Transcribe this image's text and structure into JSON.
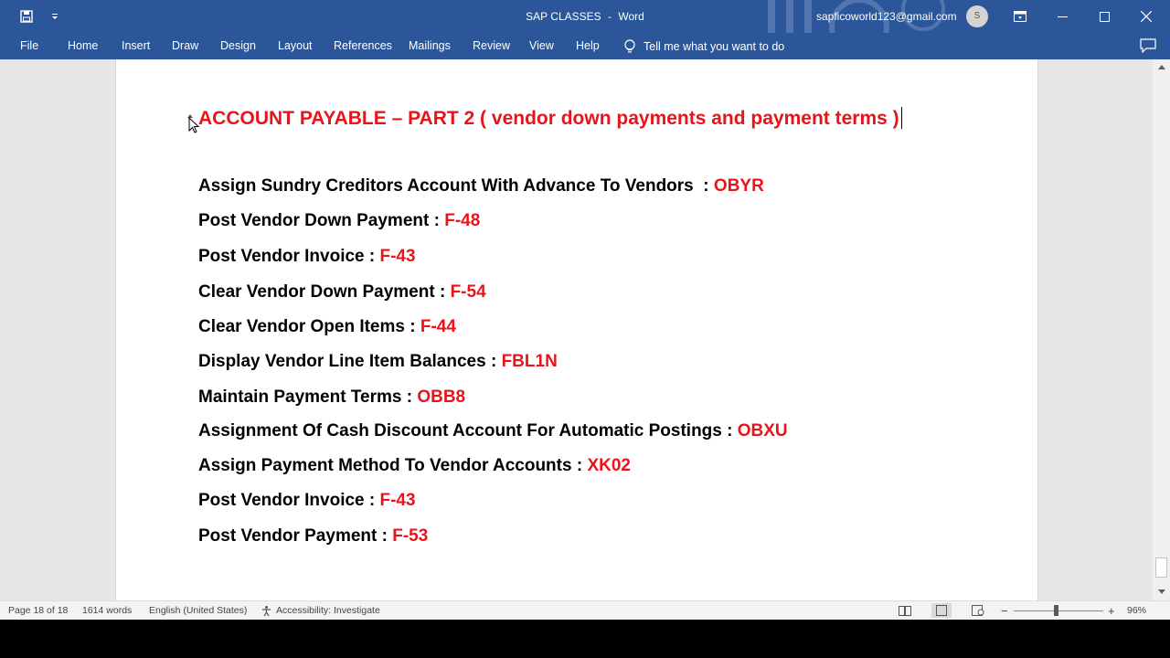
{
  "window": {
    "doc_name": "SAP CLASSES",
    "separator": "-",
    "app_name": "Word",
    "user_email": "sapficoworld123@gmail.com",
    "avatar_initial": "S",
    "title_bar_color": "#2b579a"
  },
  "menu": {
    "tabs": [
      "File",
      "Home",
      "Insert",
      "Draw",
      "Design",
      "Layout",
      "References",
      "Mailings",
      "Review",
      "View",
      "Help"
    ],
    "tell_me": "Tell me what you want to do"
  },
  "document": {
    "heading": "ACCOUNT PAYABLE – PART 2 ( vendor down payments and payment terms )",
    "heading_color": "#e8141a",
    "lines": [
      {
        "label": "Assign Sundry Creditors Account With Advance To Vendors  : ",
        "code": "OBYR"
      },
      {
        "label": "Post Vendor Down Payment : ",
        "code": "F-48"
      },
      {
        "label": "Post Vendor Invoice : ",
        "code": "F-43"
      },
      {
        "label": "Clear Vendor Down Payment : ",
        "code": "F-54"
      },
      {
        "label": "Clear Vendor Open Items : ",
        "code": "F-44"
      },
      {
        "label": "Display Vendor Line Item Balances : ",
        "code": "FBL1N"
      },
      {
        "label": "Maintain Payment Terms : ",
        "code": "OBB8"
      },
      {
        "label": "Assignment Of Cash Discount Account For Automatic Postings : ",
        "code": "OBXU"
      },
      {
        "label": "Assign Payment Method To Vendor Accounts : ",
        "code": "XK02"
      },
      {
        "label": "Post Vendor Invoice : ",
        "code": "F-43"
      },
      {
        "label": "Post Vendor Payment : ",
        "code": "F-53"
      }
    ]
  },
  "status": {
    "page": "Page 18 of 18",
    "words": "1614 words",
    "language": "English (United States)",
    "accessibility": "Accessibility: Investigate",
    "zoom_minus": "−",
    "zoom_plus": "+",
    "zoom": "96%"
  }
}
